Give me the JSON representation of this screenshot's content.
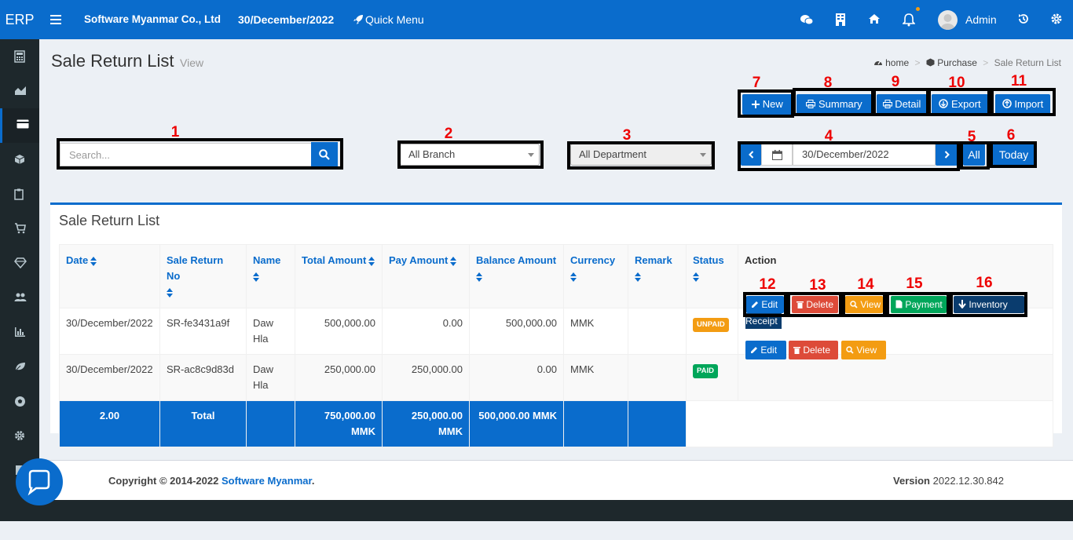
{
  "app": {
    "logo": "ERP",
    "company": "Software Myanmar Co., Ltd",
    "date": "30/December/2022",
    "quick_menu": "Quick Menu",
    "user": "Admin"
  },
  "page": {
    "title": "Sale Return List",
    "subtitle": "View"
  },
  "breadcrumb": {
    "home": "home",
    "sep1": ">",
    "purchase": "Purchase",
    "sep2": ">",
    "current": "Sale Return List"
  },
  "toolbar": {
    "new": "New",
    "summary": "Summary",
    "detail": "Detail",
    "export": "Export",
    "import": "Import"
  },
  "filters": {
    "search_placeholder": "Search...",
    "branch": "All Branch",
    "department": "All Department",
    "date": "30/December/2022",
    "all": "All",
    "today": "Today"
  },
  "annotations": [
    "1",
    "2",
    "3",
    "4",
    "5",
    "6",
    "7",
    "8",
    "9",
    "10",
    "11",
    "12",
    "13",
    "14",
    "15",
    "16"
  ],
  "table": {
    "title": "Sale Return List",
    "headers": {
      "date": "Date",
      "no": "Sale Return No",
      "name": "Name",
      "total": "Total Amount",
      "pay": "Pay Amount",
      "balance": "Balance Amount",
      "currency": "Currency",
      "remark": "Remark",
      "status": "Status",
      "action": "Action"
    },
    "rows": [
      {
        "date": "30/December/2022",
        "no": "SR-fe3431a9f",
        "name": "Daw Hla",
        "total": "500,000.00",
        "pay": "0.00",
        "balance": "500,000.00",
        "currency": "MMK",
        "remark": "",
        "status": "UNPAID",
        "status_color": "#f39c12"
      },
      {
        "date": "30/December/2022",
        "no": "SR-ac8c9d83d",
        "name": "Daw Hla",
        "total": "250,000.00",
        "pay": "250,000.00",
        "balance": "0.00",
        "currency": "MMK",
        "remark": "",
        "status": "PAID",
        "status_color": "#00a65a"
      }
    ],
    "totals": {
      "count": "2.00",
      "label": "Total",
      "total": "750,000.00 MMK",
      "pay": "250,000.00 MMK",
      "balance": "500,000.00 MMK"
    }
  },
  "actions": {
    "edit": "Edit",
    "delete": "Delete",
    "view": "View",
    "payment": "Payment",
    "inventory": "Inventory",
    "receipt": "Receipt"
  },
  "footer": {
    "copyright": "Copyright © 2014-2022",
    "brand": "Software Myanmar",
    "dot": ".",
    "version_label": "Version",
    "version": "2022.12.30.842"
  },
  "colors": {
    "primary": "#0a6ccc",
    "danger": "#dd4b39",
    "warning": "#f39c12",
    "success": "#00a65a",
    "sidebar": "#1e282c"
  },
  "icons": [
    "menu-icon",
    "rocket-icon",
    "wechat-icon",
    "building-icon",
    "home-icon",
    "bell-icon",
    "history-icon",
    "gear-icon",
    "calendar-icon",
    "search-icon",
    "print-icon",
    "plus-icon",
    "pencil-icon",
    "trash-icon",
    "file-icon",
    "arrow-down-icon",
    "chat-bubble-icon"
  ]
}
